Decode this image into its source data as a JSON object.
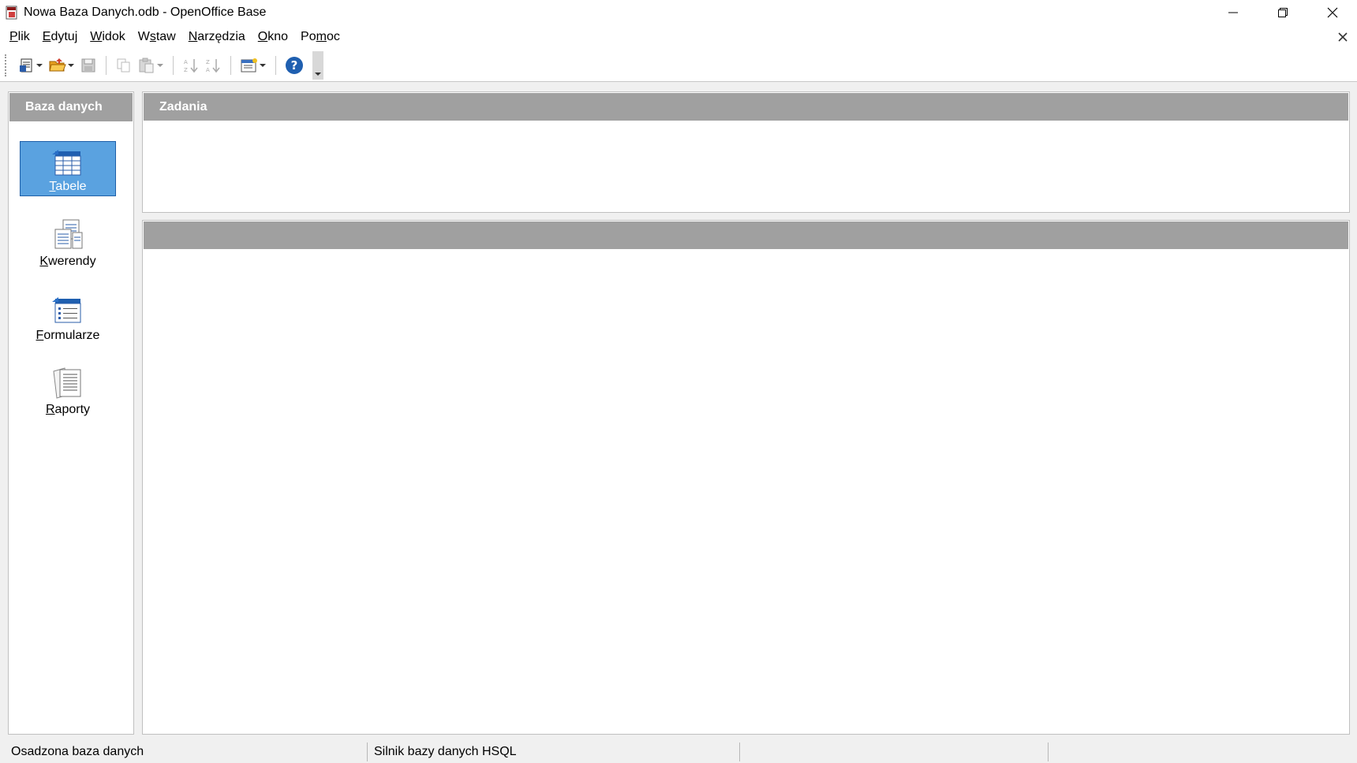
{
  "window": {
    "title": "Nowa Baza Danych.odb - OpenOffice Base"
  },
  "menu": {
    "items": [
      {
        "first": "P",
        "rest": "lik"
      },
      {
        "first": "E",
        "rest": "dytuj"
      },
      {
        "first": "W",
        "rest": "idok"
      },
      {
        "pre": "W",
        "first": "s",
        "rest": "taw"
      },
      {
        "first": "N",
        "rest": "arzędzia"
      },
      {
        "first": "O",
        "rest": "kno"
      },
      {
        "pre": "Po",
        "first": "m",
        "rest": "oc"
      }
    ]
  },
  "toolbar": {
    "icons": [
      "new-document-icon",
      "open-folder-icon",
      "save-icon",
      "copy-icon",
      "paste-icon",
      "sort-ascending-icon",
      "sort-descending-icon",
      "form-view-icon",
      "help-icon"
    ]
  },
  "left_panel": {
    "header": "Baza danych",
    "items": [
      {
        "first": "T",
        "rest": "abele",
        "icon": "tables-icon",
        "selected": true
      },
      {
        "first": "K",
        "rest": "werendy",
        "icon": "queries-icon",
        "selected": false
      },
      {
        "first": "F",
        "rest": "ormularze",
        "icon": "forms-icon",
        "selected": false
      },
      {
        "first": "R",
        "rest": "aporty",
        "icon": "reports-icon",
        "selected": false
      }
    ]
  },
  "tasks_panel": {
    "header": "Zadania"
  },
  "content_panel": {
    "header": ""
  },
  "statusbar": {
    "cells": [
      "Osadzona baza danych",
      "Silnik bazy danych HSQL",
      "",
      ""
    ]
  },
  "colors": {
    "panel_header": "#a0a0a0",
    "selected_bg": "#5aa2e0",
    "selected_border": "#1f5fa8"
  }
}
